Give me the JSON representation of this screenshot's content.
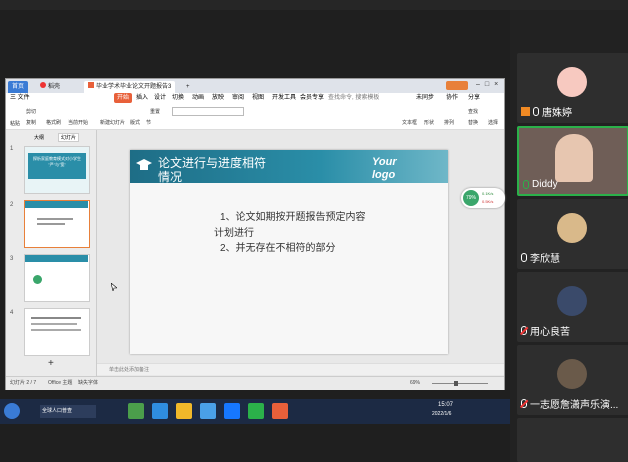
{
  "wps": {
    "tabs": {
      "home": "首页",
      "wps": "稻壳",
      "doc": "毕业学术毕业论文开题报告3",
      "plus": "+"
    },
    "menu": [
      "三 文件",
      "开始",
      "插入",
      "设计",
      "切换",
      "动画",
      "放映",
      "审阅",
      "视图",
      "开发工具",
      "会员专享",
      "查找命令, 搜索模板"
    ],
    "menu_right": [
      "未同步",
      "协作",
      "分享"
    ],
    "ribbon": [
      "粘贴",
      "剪切",
      "复制",
      "格式刷",
      "当前开始",
      "新建幻灯片",
      "版式",
      "节",
      "重置",
      "文本框",
      "形状",
      "排列",
      "查找",
      "替换",
      "选择"
    ],
    "thumb_tabs": [
      "大纲",
      "幻灯片"
    ],
    "status": [
      "幻灯片 2 / 7",
      "Office 主题",
      "缺失字体"
    ],
    "notes": "单击此处添加备注",
    "zoom": "69%"
  },
  "slide": {
    "title": "论文进行与进度相符情况",
    "brand": "Your logo",
    "lines": [
      "1、论文如期按开题报告预定内容",
      "计划进行",
      "2、并无存在不相符的部分"
    ]
  },
  "thumb1": {
    "title": "探析家庭教育模式对小学生",
    "sub": "\"严\"与\"宽\""
  },
  "taskbar": {
    "time": "15:07",
    "date": "2022/1/6",
    "ie_label": "全球人口普查"
  },
  "participants": [
    {
      "name": "唐姝婷",
      "muted": false,
      "host": true
    },
    {
      "name": "Diddy",
      "muted": false,
      "active": true
    },
    {
      "name": "李欣慧",
      "muted": false
    },
    {
      "name": "用心良苦",
      "muted": true
    },
    {
      "name": "一志愿詹潇声乐演...",
      "muted": true
    }
  ],
  "float": {
    "pct": "79%",
    "up": "0.1K/s",
    "down": "0.5K/s"
  }
}
